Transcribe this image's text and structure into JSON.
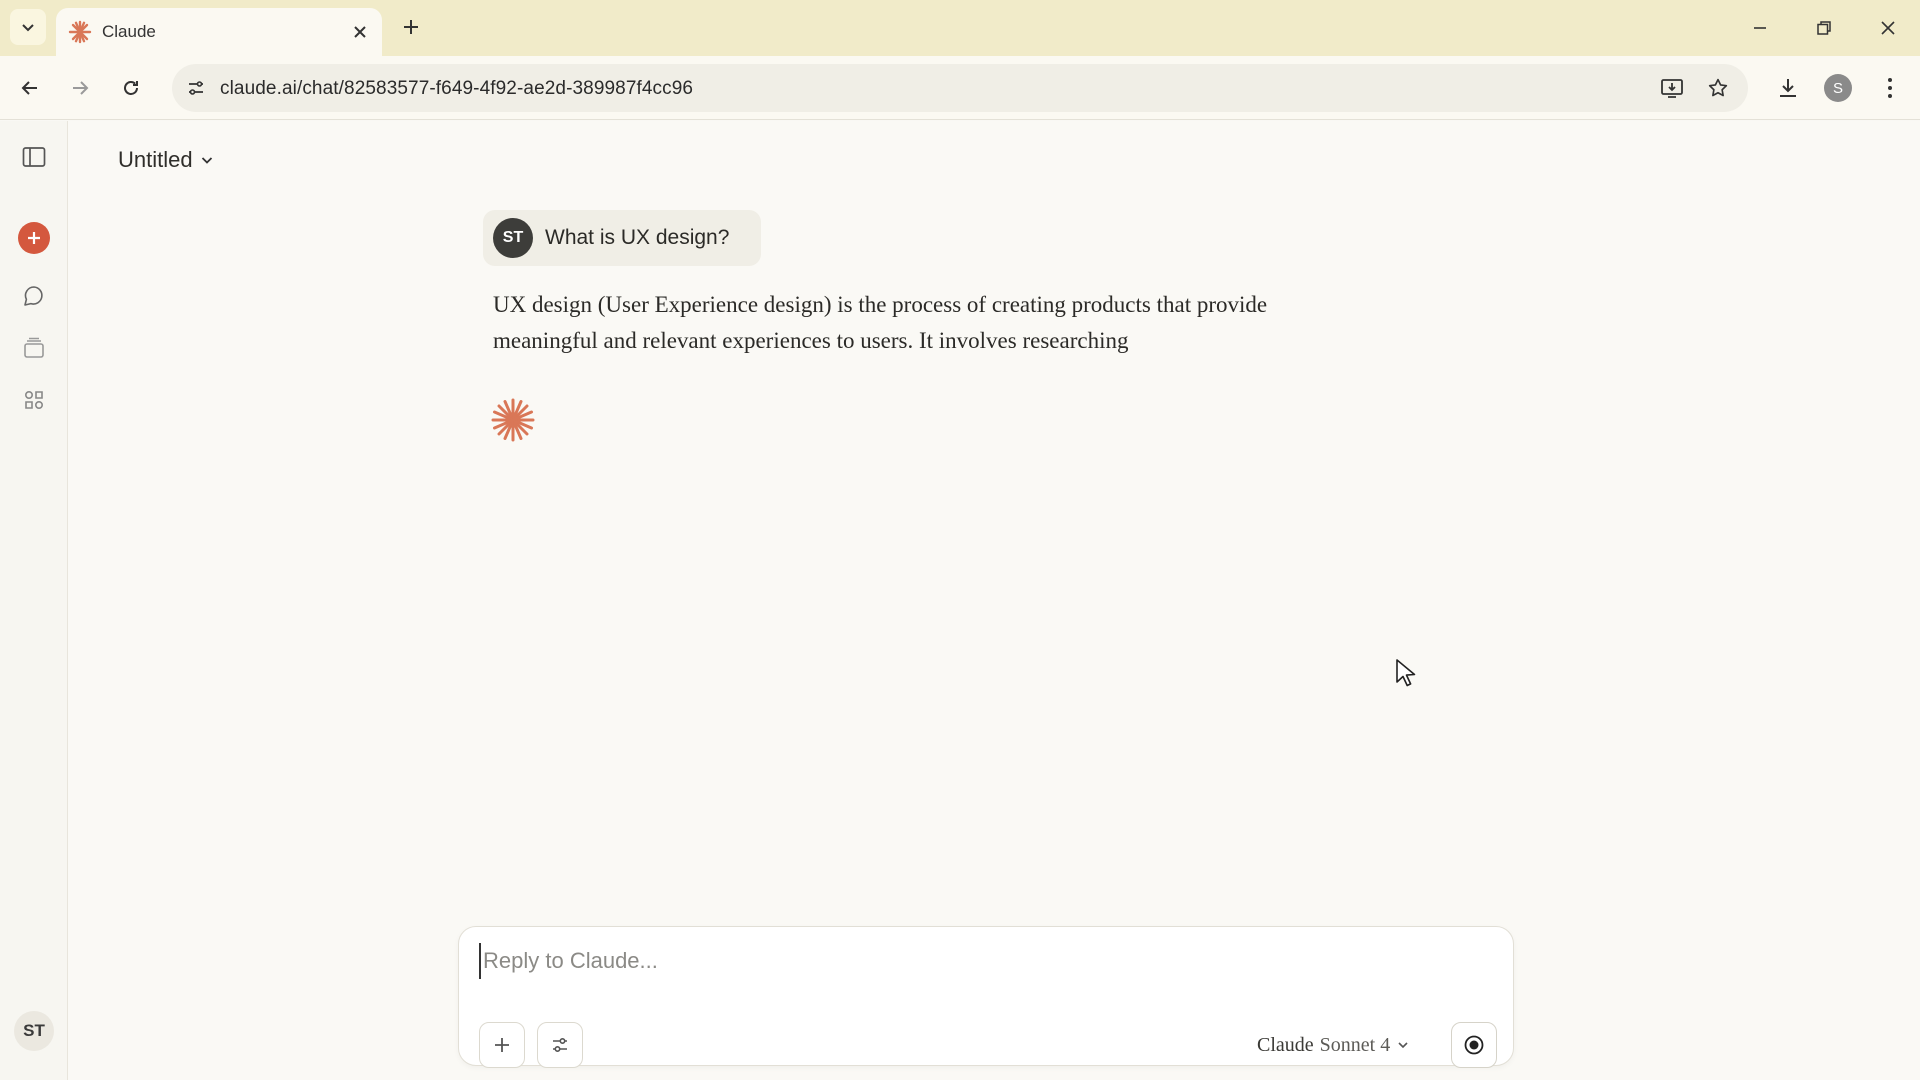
{
  "browser": {
    "tab_title": "Claude",
    "url": "claude.ai/chat/82583577-f649-4f92-ae2d-389987f4cc96",
    "profile_initial": "S"
  },
  "app": {
    "chat_title": "Untitled",
    "sidebar_avatar": "ST",
    "accent_color": "#d4583e"
  },
  "conversation": {
    "user": {
      "avatar": "ST",
      "message": "What is UX design?"
    },
    "assistant": {
      "line1": "UX design (User Experience design) is the process of creating products that provide",
      "line2": "meaningful and relevant experiences to users. It involves researching"
    }
  },
  "composer": {
    "placeholder": "Reply to Claude...",
    "model_name": "Claude",
    "model_version": "Sonnet 4"
  },
  "icons": [
    "tab-list-icon",
    "claude-spark-icon",
    "close-icon",
    "plus-icon",
    "minimize-icon",
    "restore-icon",
    "back-icon",
    "forward-icon",
    "reload-icon",
    "site-info-icon",
    "install-app-icon",
    "bookmark-star-icon",
    "download-icon",
    "kebab-menu-icon",
    "sidebar-toggle-icon",
    "search-chats-icon",
    "projects-icon",
    "artifacts-icon",
    "tools-sliders-icon",
    "chevron-down-icon",
    "voice-icon"
  ]
}
